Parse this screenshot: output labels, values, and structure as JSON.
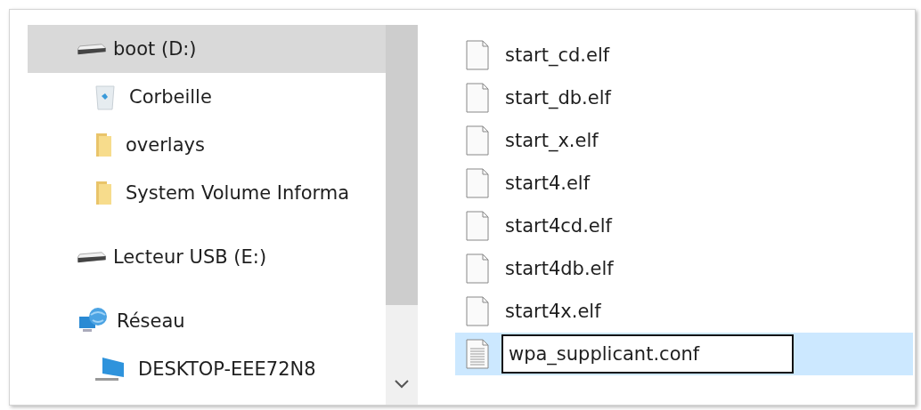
{
  "navigation": {
    "items": [
      {
        "label": "boot (D:)",
        "kind": "drive",
        "selected": true,
        "children": [
          {
            "label": "Corbeille",
            "kind": "recycle",
            "selected": false
          },
          {
            "label": "overlays",
            "kind": "folder",
            "selected": false
          },
          {
            "label": "System Volume Informa",
            "kind": "folder",
            "selected": false
          }
        ]
      },
      {
        "label": "Lecteur USB (E:)",
        "kind": "drive",
        "selected": false
      },
      {
        "label": "Réseau",
        "kind": "network",
        "selected": false,
        "children": [
          {
            "label": "DESKTOP-EEE72N8",
            "kind": "computer",
            "selected": false
          }
        ]
      }
    ]
  },
  "files": [
    {
      "name": "start_cd.elf",
      "kind": "blank",
      "selected": false
    },
    {
      "name": "start_db.elf",
      "kind": "blank",
      "selected": false
    },
    {
      "name": "start_x.elf",
      "kind": "blank",
      "selected": false
    },
    {
      "name": "start4.elf",
      "kind": "blank",
      "selected": false
    },
    {
      "name": "start4cd.elf",
      "kind": "blank",
      "selected": false
    },
    {
      "name": "start4db.elf",
      "kind": "blank",
      "selected": false
    },
    {
      "name": "start4x.elf",
      "kind": "blank",
      "selected": false
    },
    {
      "name": "wpa_supplicant.conf",
      "kind": "text",
      "selected": true,
      "renaming": true
    }
  ]
}
